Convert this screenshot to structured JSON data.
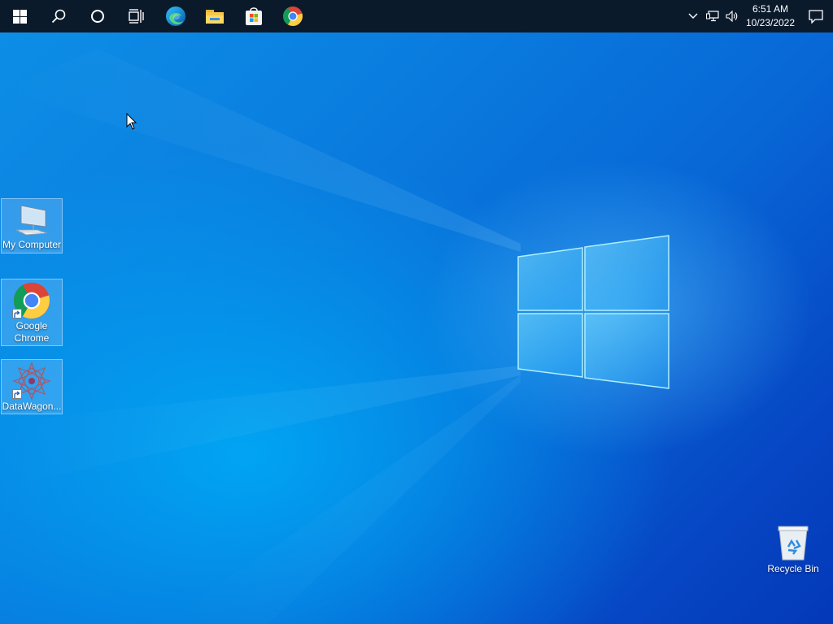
{
  "taskbar": {
    "start": {
      "icon": "windows-logo-icon"
    },
    "search": {
      "icon": "search-icon"
    },
    "cortana": {
      "icon": "cortana-circle-icon"
    },
    "task_view": {
      "icon": "task-view-icon"
    },
    "pinned": [
      {
        "name": "edge",
        "icon": "edge-icon"
      },
      {
        "name": "file-explorer",
        "icon": "folder-icon"
      },
      {
        "name": "store",
        "icon": "store-icon"
      },
      {
        "name": "chrome",
        "icon": "chrome-icon"
      }
    ],
    "tray": {
      "chevron_icon": "chevron-up-icon",
      "network_icon": "network-icon",
      "volume_icon": "volume-icon",
      "time": "6:51 AM",
      "date": "10/23/2022",
      "notification_icon": "action-center-icon"
    },
    "background": "#0b1a2b"
  },
  "desktop": {
    "icons": [
      {
        "label": "My Computer",
        "icon": "computer-icon"
      },
      {
        "label": "Google Chrome",
        "icon": "chrome-icon",
        "shortcut": true
      },
      {
        "label": "DataWagon...",
        "icon": "datawagon-icon",
        "shortcut": true
      },
      {
        "label": "Recycle Bin",
        "icon": "recycle-bin-icon"
      }
    ]
  },
  "colors": {
    "wallpaper_light": "#19b3f5",
    "wallpaper_dark": "#0439b8",
    "accent": "#0078d7"
  }
}
